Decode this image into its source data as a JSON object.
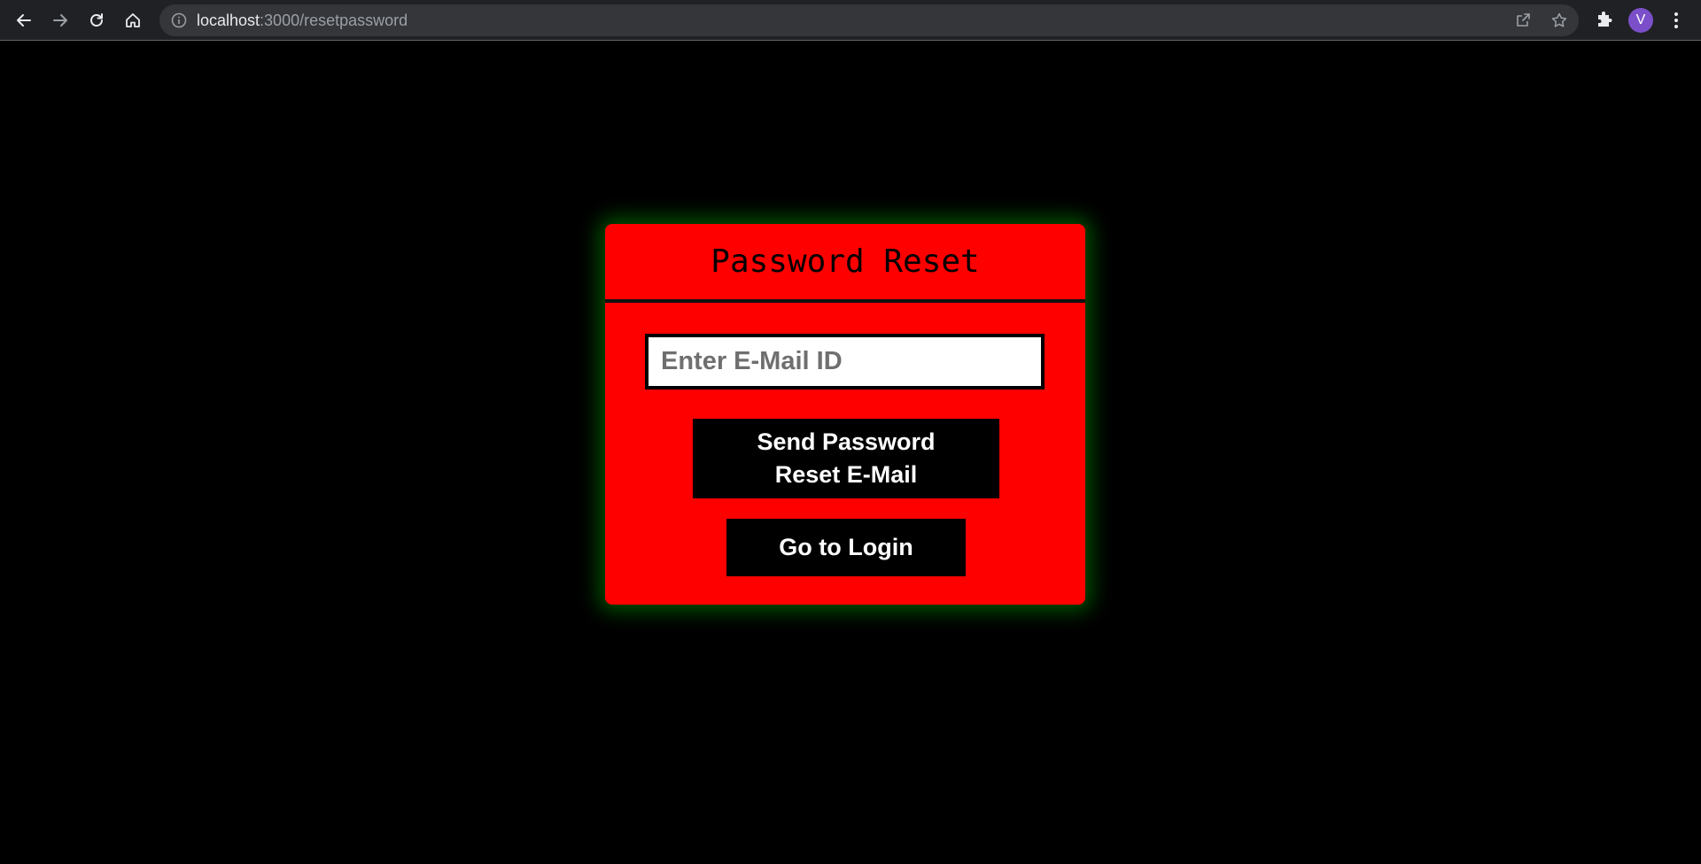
{
  "browser": {
    "url_host": "localhost",
    "url_path": ":3000/resetpassword",
    "profile_initial": "V",
    "icons": {
      "back": "arrow-left-icon",
      "forward": "arrow-right-icon",
      "reload": "reload-icon",
      "home": "home-icon",
      "site_info": "info-icon",
      "share": "share-icon",
      "bookmark": "star-icon",
      "extensions": "puzzle-icon",
      "menu": "kebab-menu-icon"
    }
  },
  "page": {
    "background_color": "#000000",
    "card": {
      "title": "Password Reset",
      "background_color": "#ff0000",
      "glow_color": "#008c00",
      "email_placeholder": "Enter E-Mail ID",
      "email_value": "",
      "send_button_label": "Send Password Reset E-Mail",
      "login_button_label": "Go to Login"
    }
  }
}
